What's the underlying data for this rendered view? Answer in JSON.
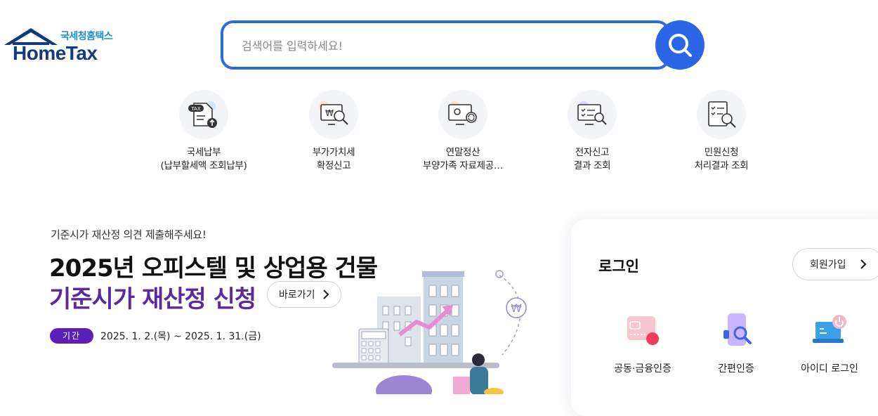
{
  "logo": {
    "korean": "국세청홈택스",
    "english": "HomeTax"
  },
  "search": {
    "placeholder": "검색어를 입력하세요!",
    "value": ""
  },
  "quick_menu": [
    {
      "line1": "국세납부",
      "line2": "(납부할세액 조회납부)",
      "icon": "tax-document-upload-icon"
    },
    {
      "line1": "부가가치세",
      "line2": "확정신고",
      "icon": "won-monitor-search-icon"
    },
    {
      "line1": "연말정산",
      "line2": "부양가족 자료제공…",
      "icon": "monitor-refresh-icon"
    },
    {
      "line1": "전자신고",
      "line2": "결과 조회",
      "icon": "checklist-monitor-icon"
    },
    {
      "line1": "민원신청",
      "line2": "처리결과 조회",
      "icon": "certificate-search-icon"
    }
  ],
  "banner": {
    "eyebrow": "기준시가 재산정 의견 제출해주세요!",
    "title_line1": "2025년 오피스텔 및 상업용 건물",
    "title_line2": "기준시가 재산정 신청",
    "goto_label": "바로가기",
    "period_badge": "기간",
    "period_dates": "2025. 1. 2.(목) ~ 2025. 1. 31.(금)"
  },
  "login": {
    "title": "로그인",
    "signup_label": "회원가입",
    "options": [
      {
        "label": "공동·금융인증",
        "icon": "certificate-card-icon"
      },
      {
        "label": "간편인증",
        "icon": "mobile-search-icon"
      },
      {
        "label": "아이디 로그인",
        "icon": "laptop-power-icon"
      }
    ]
  },
  "colors": {
    "primary": "#2a66e6",
    "banner_accent": "#5a2a9e",
    "badge": "#5b1fb8",
    "logo_navy": "#123a7c"
  }
}
